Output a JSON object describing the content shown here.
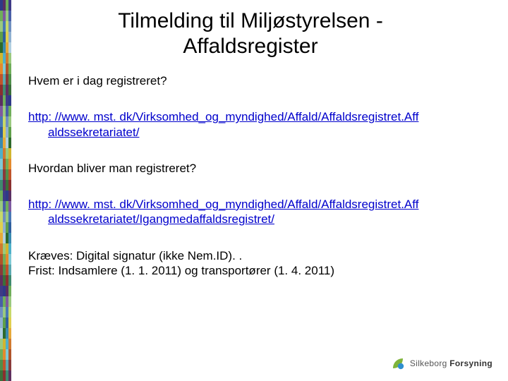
{
  "title_line1": "Tilmelding til Miljøstyrelsen -",
  "title_line2": "Affaldsregister",
  "q1": "Hvem er i dag registreret?",
  "link1_a": "http: //www. mst. dk/Virksomhed_og_myndighed/Affald/Affaldsregistret.Aff",
  "link1_b": "aldssekretariatet/",
  "q2": "Hvordan bliver man registreret?",
  "link2_a": "http: //www. mst. dk/Virksomhed_og_myndighed/Affald/Affaldsregistret.Aff",
  "link2_b": "aldssekretariatet/Igangmedaffaldsregistret/",
  "req": "Kræves: Digital signatur (ikke Nem.ID). .",
  "frist": "Frist: Indsamlere (1. 1. 2011) og transportører (1. 4. 2011)",
  "logo_a": "Silkeborg",
  "logo_b": "Forsyning",
  "stripe_colors": [
    "#2e3a87",
    "#6fae5a",
    "#9ac97f",
    "#5f9f49",
    "#2e6a2b",
    "#d1b52f",
    "#e48a2d",
    "#c0542a",
    "#8a2f2f",
    "#5a2f63",
    "#7e5aa0",
    "#4a78b5",
    "#2f5f9e",
    "#3a8ab0",
    "#4fb0c9",
    "#7fcad6",
    "#5aa9b0",
    "#3e8a6f",
    "#6fae5a",
    "#9ac97f",
    "#c7d96a",
    "#e0cf4f",
    "#e6a93a",
    "#d17a2f",
    "#b0542a",
    "#8a3a3a",
    "#5f2f5f",
    "#3e3a87",
    "#4a5fa8",
    "#6f8fc0",
    "#8fb0d1",
    "#b0cfe0",
    "#9ac97f",
    "#6fae5a",
    "#4f8f4a",
    "#3a6f3a"
  ]
}
